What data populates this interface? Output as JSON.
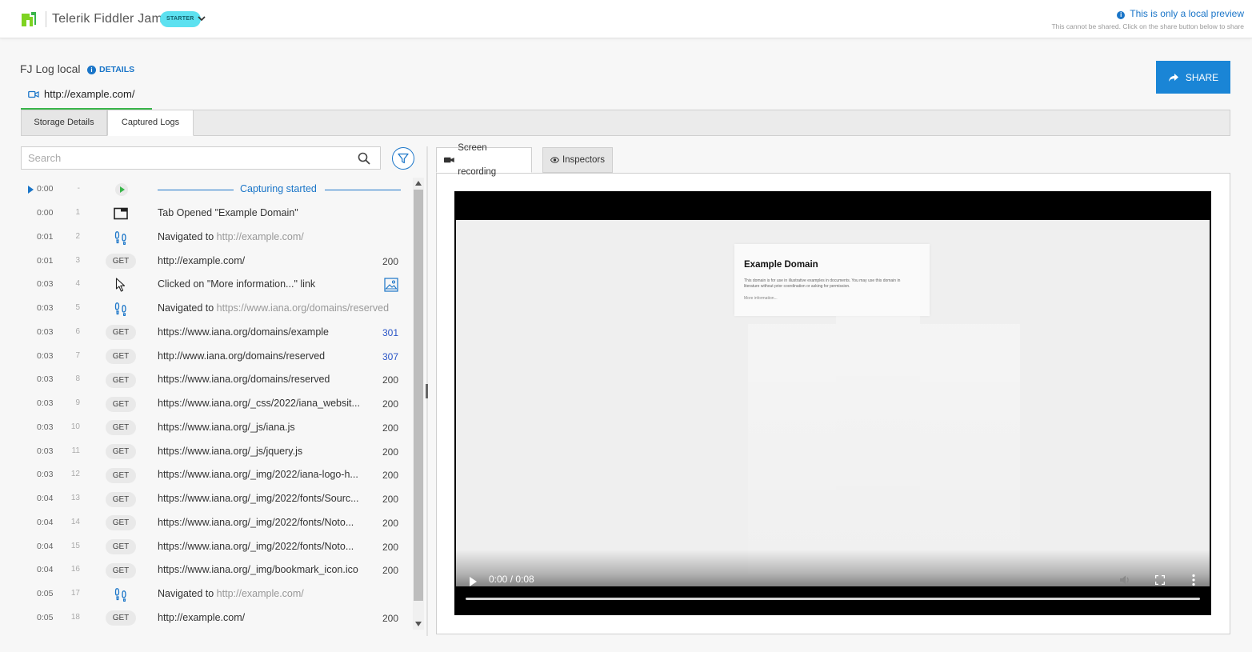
{
  "header": {
    "brand": "Telerik Fiddler Jam",
    "plan_badge": "STARTER",
    "preview_title": "This is only a local preview",
    "preview_subtitle": "This cannot be shared. Click on the share button below to share"
  },
  "log": {
    "title": "FJ Log local",
    "details_label": "DETAILS",
    "url": "http://example.com/",
    "share_label": "SHARE"
  },
  "tabs": [
    {
      "label": "Storage Details"
    },
    {
      "label": "Captured Logs"
    }
  ],
  "search": {
    "placeholder": "Search",
    "value": ""
  },
  "capture_start": {
    "time": "0:00",
    "idx": "-",
    "label": "Capturing started"
  },
  "entries": [
    {
      "time": "0:00",
      "idx": "1",
      "icon": "tab-icon",
      "text": "Tab Opened \"Example Domain\"",
      "status": ""
    },
    {
      "time": "0:01",
      "idx": "2",
      "icon": "footsteps-icon",
      "prefix": "Navigated to ",
      "text": "http://example.com/",
      "status": ""
    },
    {
      "time": "0:01",
      "idx": "3",
      "icon": "GET",
      "text": "http://example.com/",
      "status": "200"
    },
    {
      "time": "0:03",
      "idx": "4",
      "icon": "cursor-icon",
      "text": "Clicked on \"More information...\" link",
      "status": ""
    },
    {
      "time": "0:03",
      "idx": "5",
      "icon": "footsteps-icon",
      "prefix": "Navigated to ",
      "text": "https://www.iana.org/domains/reserved",
      "status": ""
    },
    {
      "time": "0:03",
      "idx": "6",
      "icon": "GET",
      "text": "https://www.iana.org/domains/example",
      "status": "301"
    },
    {
      "time": "0:03",
      "idx": "7",
      "icon": "GET",
      "text": "http://www.iana.org/domains/reserved",
      "status": "307"
    },
    {
      "time": "0:03",
      "idx": "8",
      "icon": "GET",
      "text": "https://www.iana.org/domains/reserved",
      "status": "200"
    },
    {
      "time": "0:03",
      "idx": "9",
      "icon": "GET",
      "text": "https://www.iana.org/_css/2022/iana_websit...",
      "status": "200"
    },
    {
      "time": "0:03",
      "idx": "10",
      "icon": "GET",
      "text": "https://www.iana.org/_js/iana.js",
      "status": "200"
    },
    {
      "time": "0:03",
      "idx": "11",
      "icon": "GET",
      "text": "https://www.iana.org/_js/jquery.js",
      "status": "200"
    },
    {
      "time": "0:03",
      "idx": "12",
      "icon": "GET",
      "text": "https://www.iana.org/_img/2022/iana-logo-h...",
      "status": "200"
    },
    {
      "time": "0:04",
      "idx": "13",
      "icon": "GET",
      "text": "https://www.iana.org/_img/2022/fonts/Sourc...",
      "status": "200"
    },
    {
      "time": "0:04",
      "idx": "14",
      "icon": "GET",
      "text": "https://www.iana.org/_img/2022/fonts/Noto...",
      "status": "200"
    },
    {
      "time": "0:04",
      "idx": "15",
      "icon": "GET",
      "text": "https://www.iana.org/_img/2022/fonts/Noto...",
      "status": "200"
    },
    {
      "time": "0:04",
      "idx": "16",
      "icon": "GET",
      "text": "https://www.iana.org/_img/bookmark_icon.ico",
      "status": "200"
    },
    {
      "time": "0:05",
      "idx": "17",
      "icon": "footsteps-icon",
      "prefix": "Navigated to ",
      "text": "http://example.com/",
      "status": ""
    },
    {
      "time": "0:05",
      "idx": "18",
      "icon": "GET",
      "text": "http://example.com/",
      "status": "200"
    }
  ],
  "viewer_tabs": {
    "recording": "Screen recording",
    "inspectors": "Inspectors"
  },
  "video": {
    "page_title": "Example Domain",
    "page_body": "This domain is for use in illustrative examples in documents. You may use this domain in literature without prior coordination or asking for permission.",
    "page_link": "More information...",
    "time": "0:00 / 0:08",
    "progress": 0
  },
  "colors": {
    "accent": "#1a75c8",
    "share": "#1a85d6",
    "active_tab": "#39b54a",
    "redirect": "#2a55c7"
  }
}
